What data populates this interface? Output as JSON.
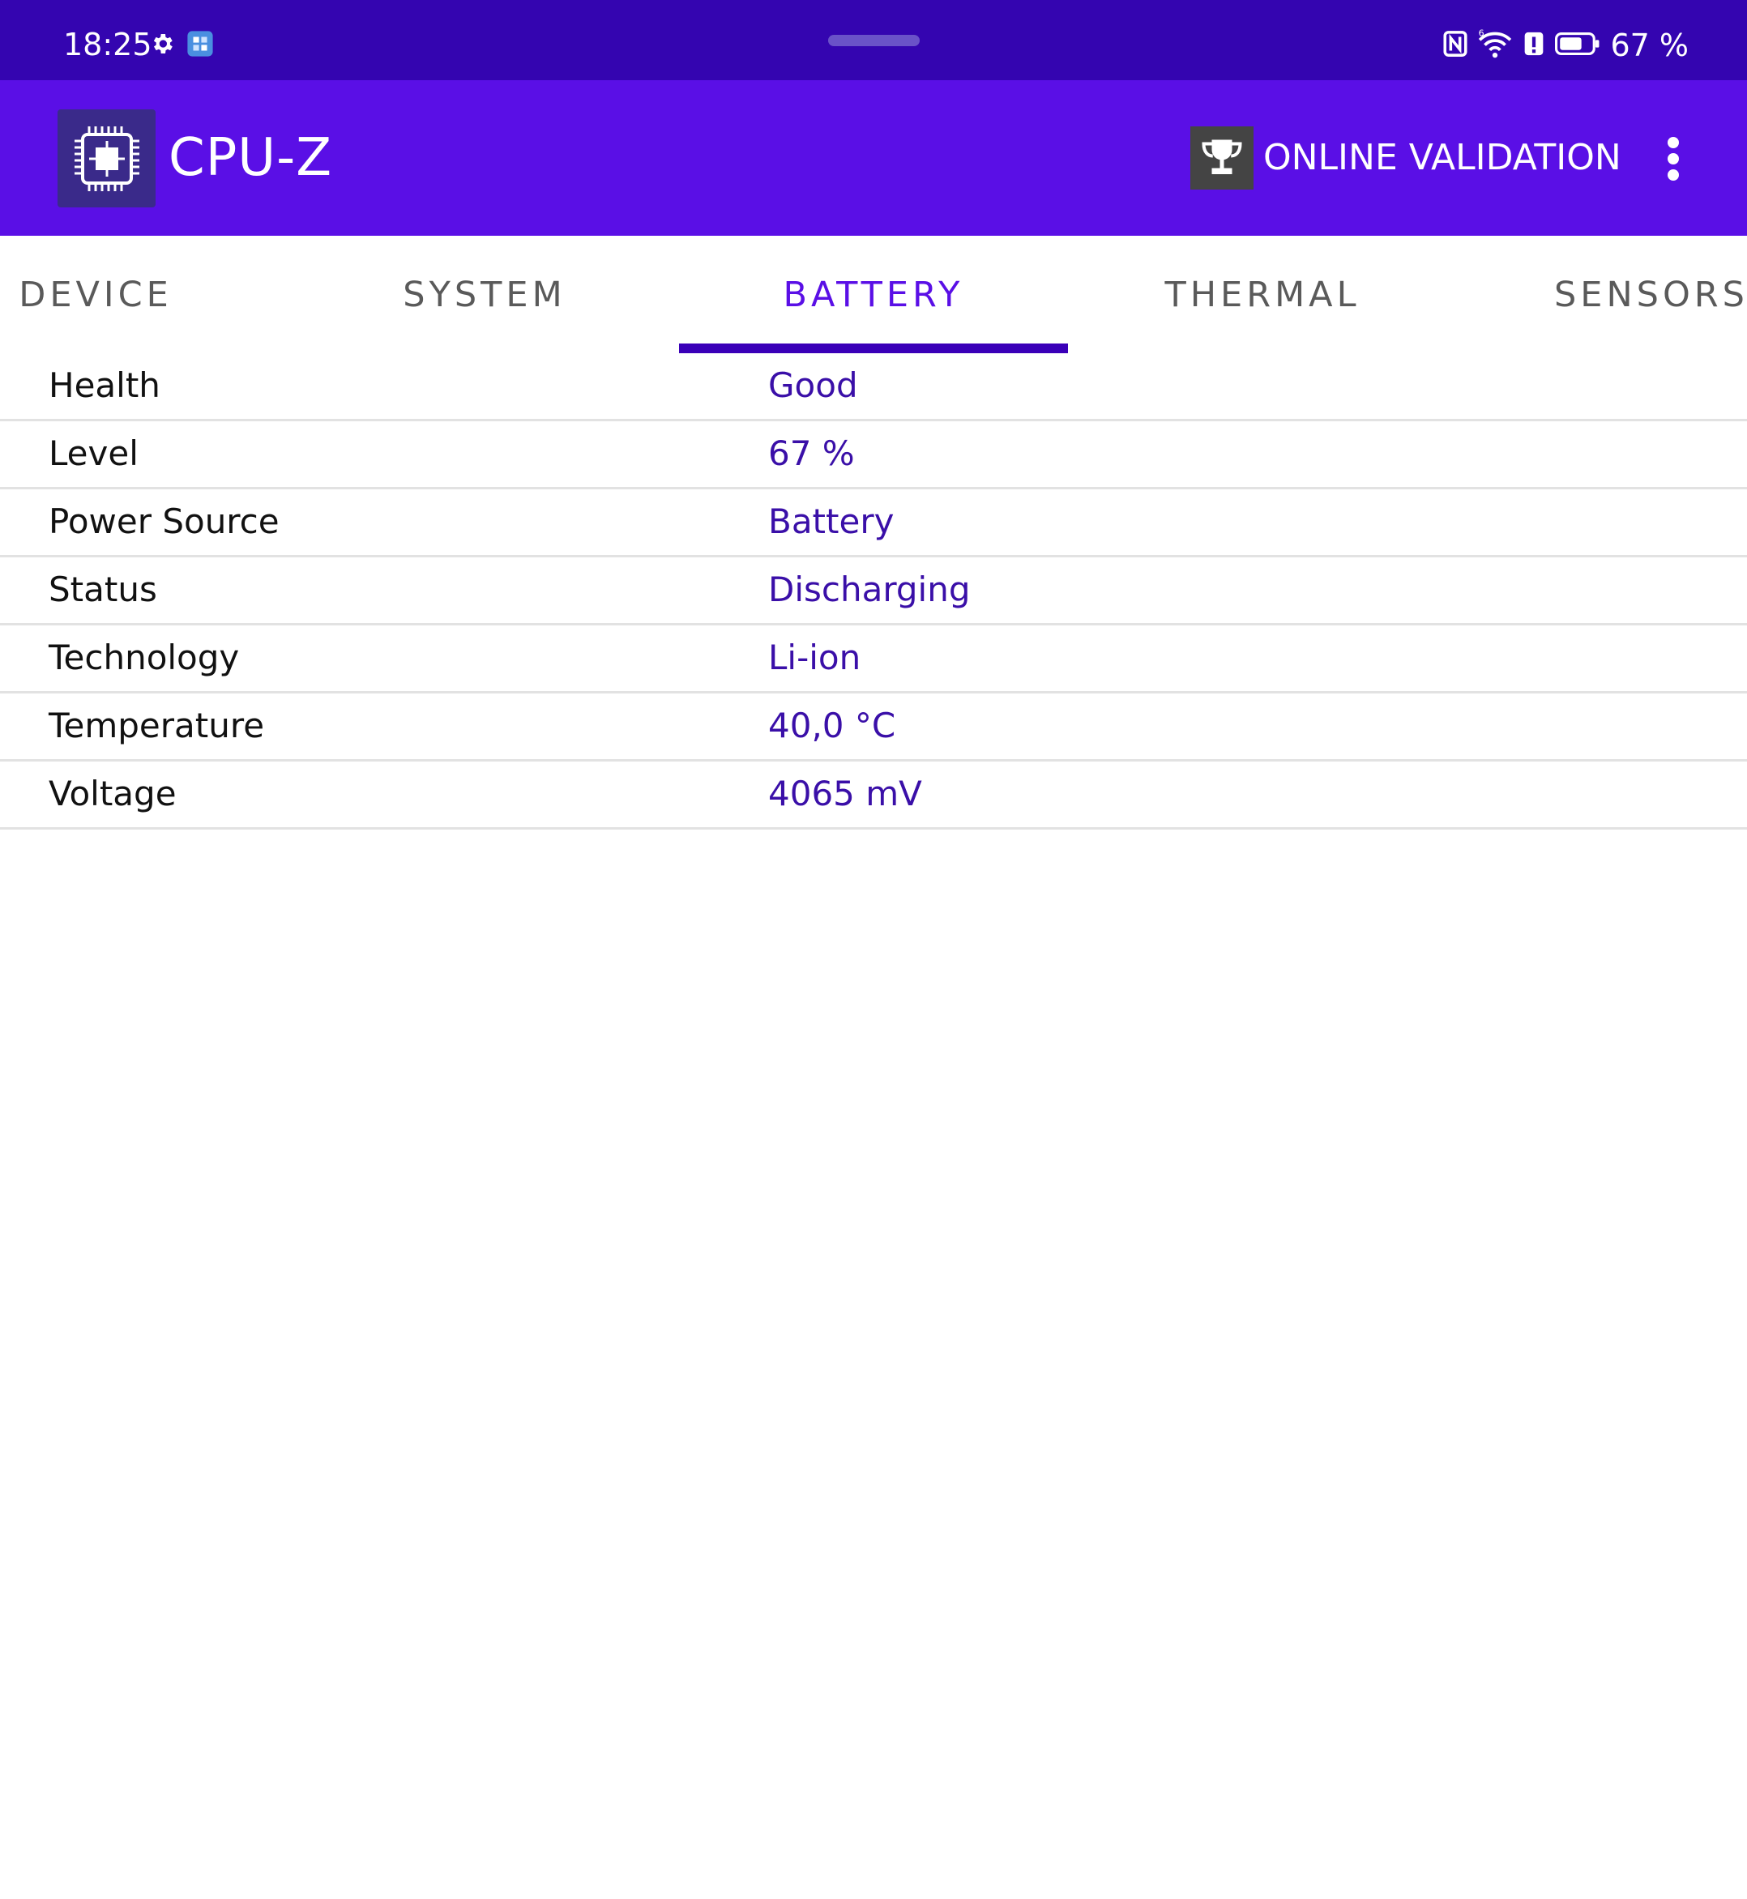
{
  "status_bar": {
    "time": "18:25",
    "battery_text": "67 %",
    "left_icons": [
      "gear-icon",
      "app-notification-icon"
    ],
    "right_icons": [
      "nfc-icon",
      "wifi-6-icon",
      "alert-icon",
      "battery-icon"
    ]
  },
  "app_bar": {
    "title": "CPU-Z",
    "validate_label": "ONLINE VALIDATION",
    "logo_icon": "cpu-chip-icon",
    "validate_icon": "trophy-icon",
    "menu_icon": "more-vert-icon"
  },
  "tabs": [
    {
      "label": "DEVICE",
      "active": false
    },
    {
      "label": "SYSTEM",
      "active": false
    },
    {
      "label": "BATTERY",
      "active": true
    },
    {
      "label": "THERMAL",
      "active": false
    },
    {
      "label": "SENSORS",
      "active": false
    }
  ],
  "battery_rows": [
    {
      "label": "Health",
      "value": "Good"
    },
    {
      "label": "Level",
      "value": "67 %"
    },
    {
      "label": "Power Source",
      "value": "Battery"
    },
    {
      "label": "Status",
      "value": "Discharging"
    },
    {
      "label": "Technology",
      "value": "Li-ion"
    },
    {
      "label": "Temperature",
      "value": "40,0 °C"
    },
    {
      "label": "Voltage",
      "value": "4065 mV"
    }
  ],
  "colors": {
    "status_bar": "#3405b0",
    "app_bar": "#5a0fe6",
    "accent": "#3a00b8",
    "value_text": "#3a0fa8"
  }
}
